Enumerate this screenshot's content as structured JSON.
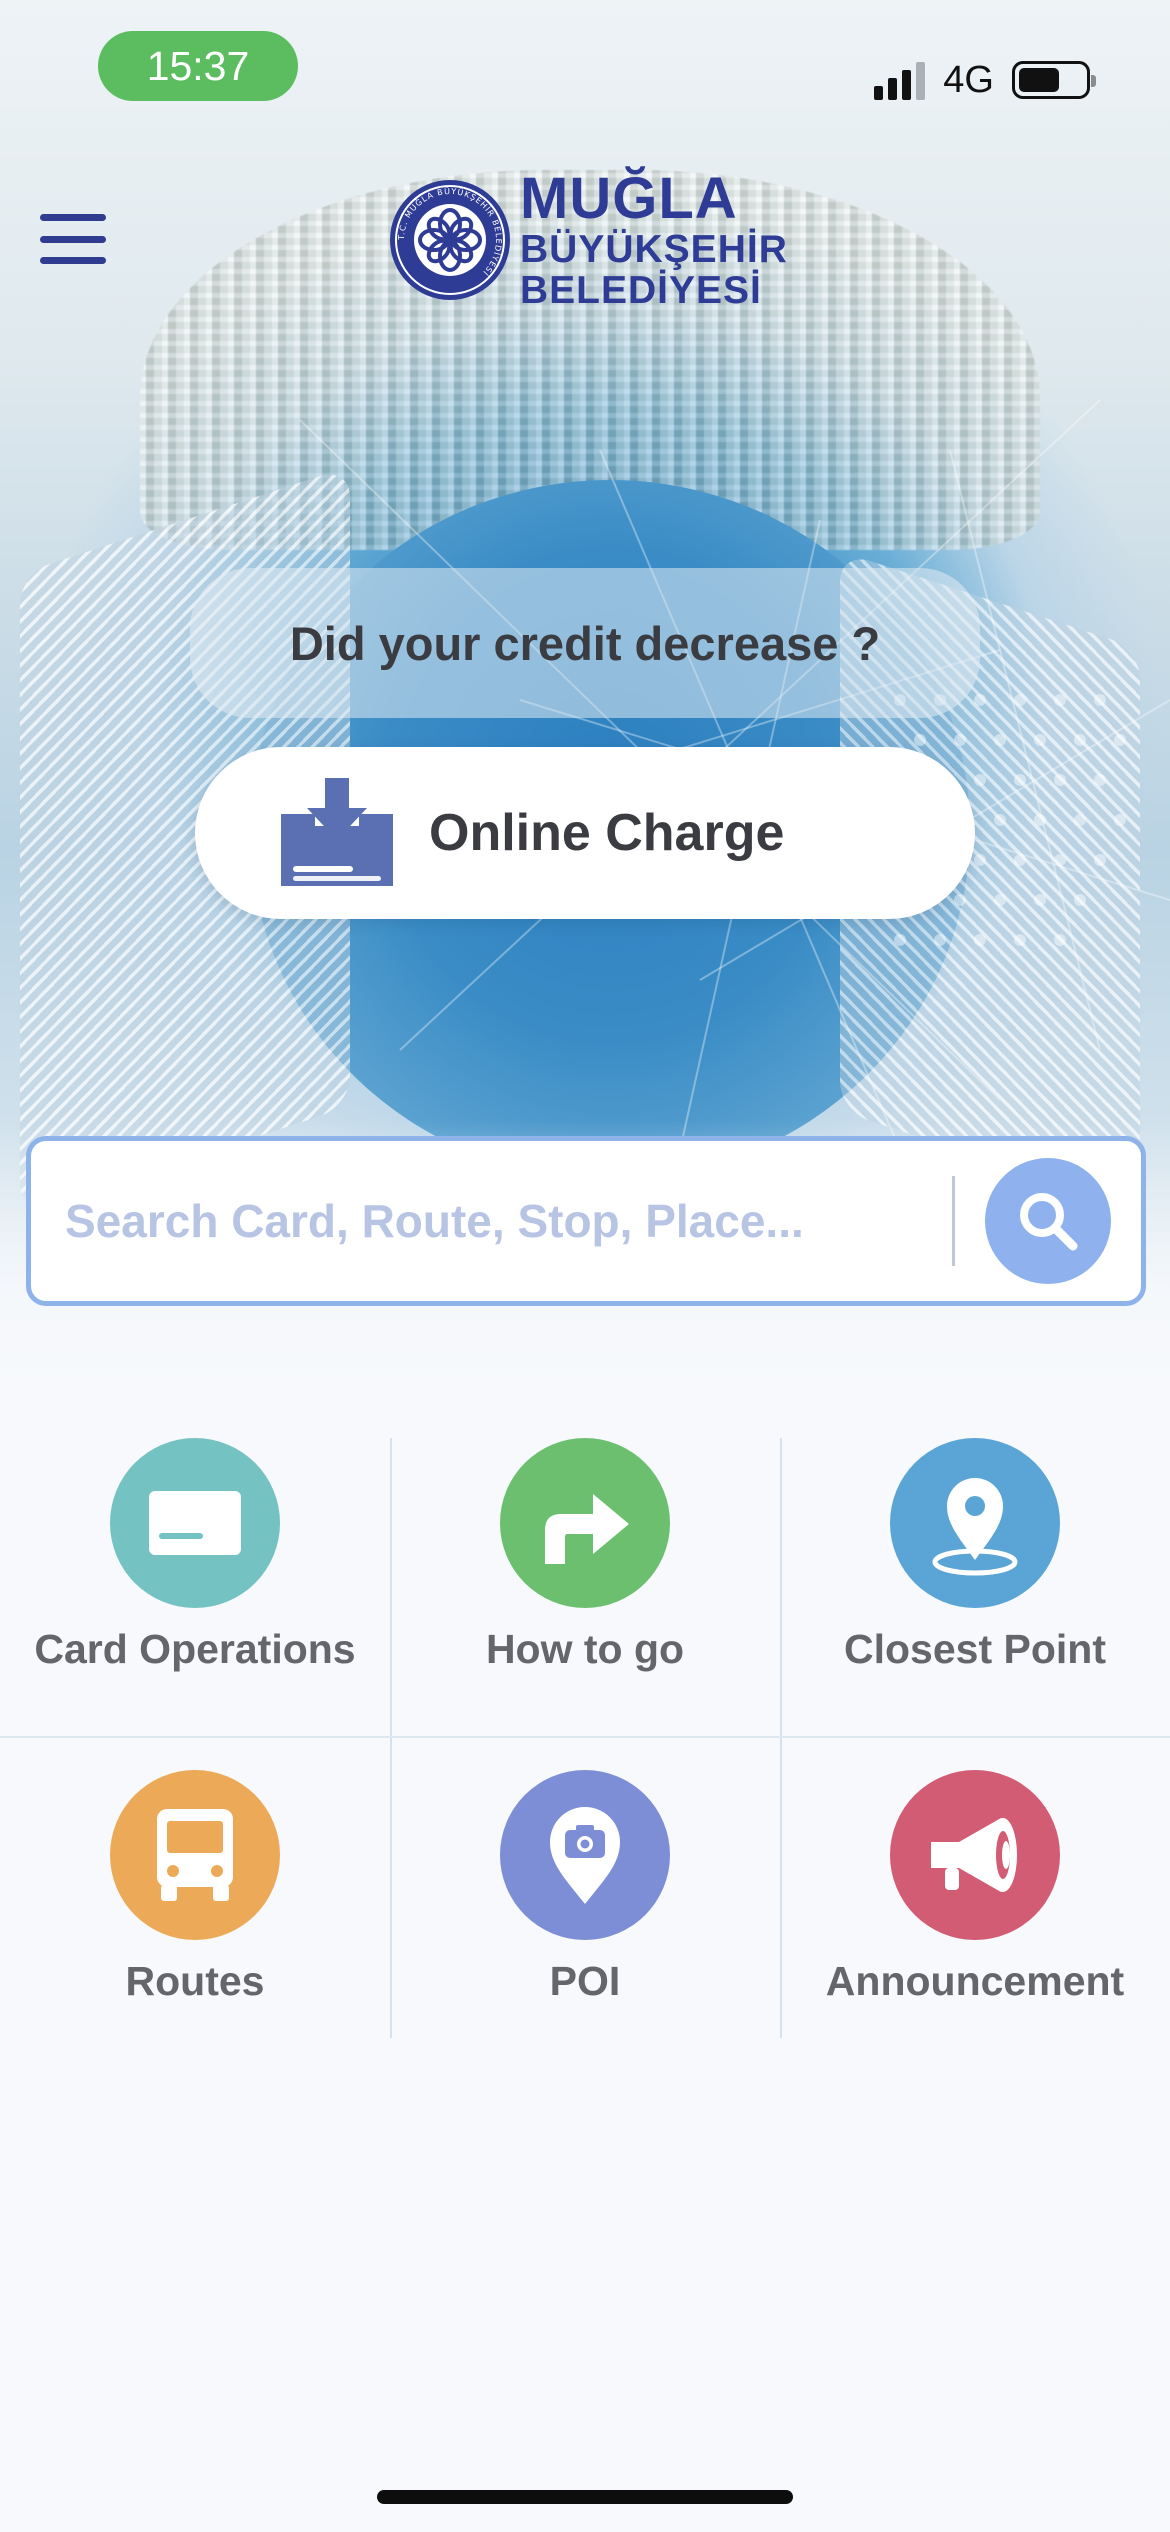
{
  "status_bar": {
    "time": "15:37",
    "network": "4G"
  },
  "header": {
    "logo": {
      "line1": "MUĞLA",
      "line2": "BÜYÜKŞEHİR",
      "line3": "BELEDİYESİ",
      "seal_text": "T.C. MUĞLA BÜYÜKŞEHİR BELEDİYESİ"
    }
  },
  "credit": {
    "prompt": "Did your credit decrease ?",
    "charge_label": "Online Charge"
  },
  "search": {
    "placeholder": "Search Card, Route, Stop, Place...",
    "value": ""
  },
  "tiles": [
    {
      "label": "Card Operations",
      "icon": "card-icon",
      "color": "#74c2c1"
    },
    {
      "label": "How to go",
      "icon": "turn-right-arrow-icon",
      "color": "#6cbf6e"
    },
    {
      "label": "Closest Point",
      "icon": "location-pin-icon",
      "color": "#5aa5d6"
    },
    {
      "label": "Routes",
      "icon": "bus-icon",
      "color": "#ecaa58"
    },
    {
      "label": "POI",
      "icon": "camera-pin-icon",
      "color": "#7d8ed6"
    },
    {
      "label": "Announcement",
      "icon": "megaphone-icon",
      "color": "#d25c73"
    }
  ],
  "colors": {
    "brand": "#2f3c95",
    "search_border": "#8eb3ea",
    "search_button": "#8fb2ee",
    "status_time_bg": "#5bbd5f"
  }
}
